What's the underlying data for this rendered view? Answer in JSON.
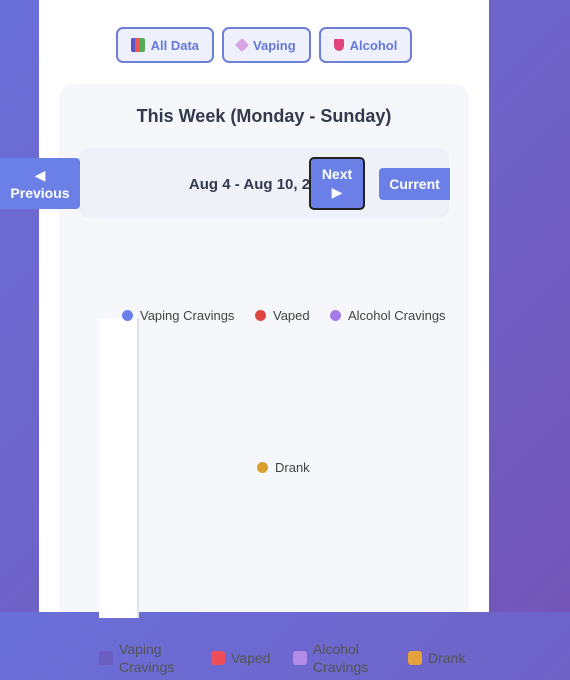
{
  "filters": [
    {
      "label": "All Data",
      "icon": "bar-chart-icon"
    },
    {
      "label": "Vaping",
      "icon": "vape-icon"
    },
    {
      "label": "Alcohol",
      "icon": "wine-glass-icon"
    }
  ],
  "week": {
    "title": "This Week (Monday - Sunday)",
    "date_range": "Aug 4 - Aug 10, 2025",
    "prev_arrow": "◀",
    "prev_label": "Previous",
    "next_label": "Next",
    "next_arrow": "▶",
    "current_label": "Current"
  },
  "chart_data": {
    "type": "scatter",
    "title": "",
    "series": [
      {
        "name": "Vaping Cravings",
        "color": "#6b80e6",
        "values": []
      },
      {
        "name": "Vaped",
        "color": "#e04545",
        "values": []
      },
      {
        "name": "Alcohol Cravings",
        "color": "#a57be6",
        "values": []
      },
      {
        "name": "Drank",
        "color": "#d9a030",
        "values": []
      }
    ]
  },
  "legend": [
    {
      "line1": "Vaping",
      "line2": "Cravings",
      "color": "#6a5fc0"
    },
    {
      "line1": "Vaped",
      "line2": "",
      "color": "#ef4d5a"
    },
    {
      "line1": "Alcohol",
      "line2": "Cravings",
      "color": "#b08ce8"
    },
    {
      "line1": "Drank",
      "line2": "",
      "color": "#e6a23a"
    }
  ]
}
